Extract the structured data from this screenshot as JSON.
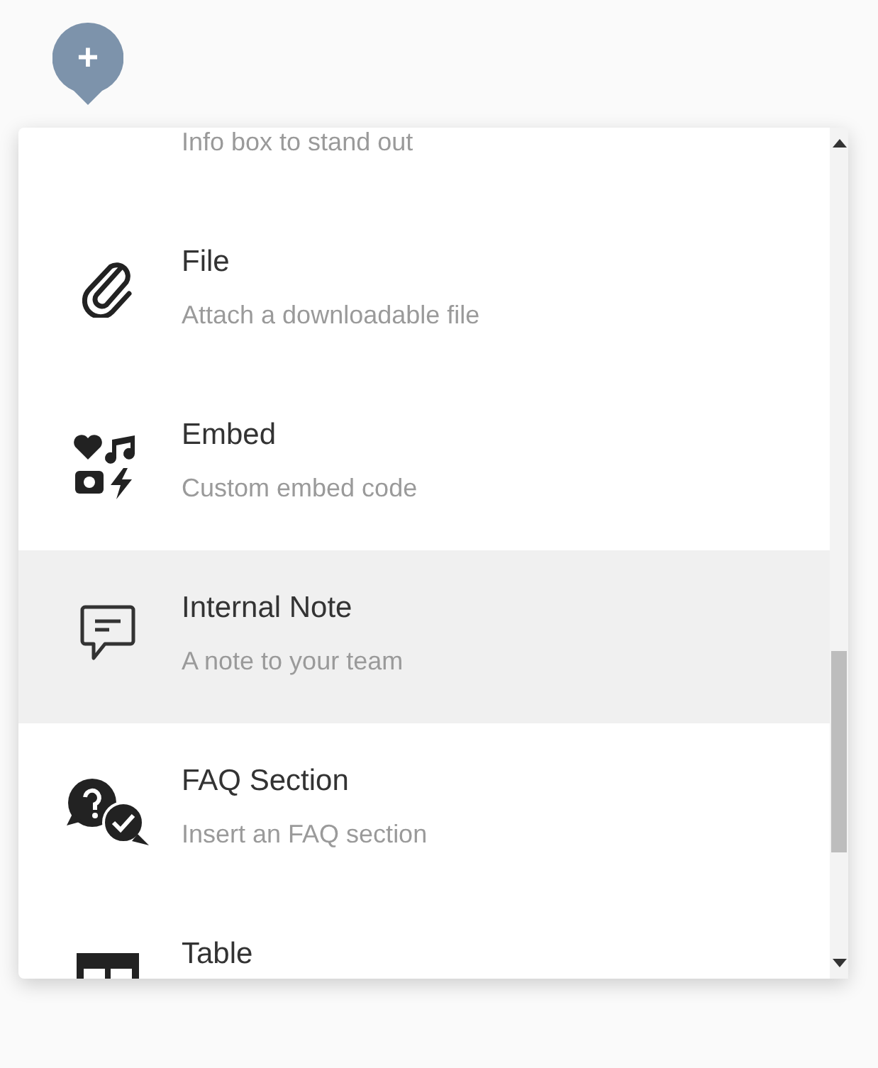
{
  "add_button": {
    "label": "+"
  },
  "insert_menu": {
    "items": [
      {
        "kind": "box",
        "description": "Info box to stand out",
        "selected": false
      },
      {
        "kind": "file",
        "title": "File",
        "description": "Attach a downloadable file",
        "selected": false
      },
      {
        "kind": "embed",
        "title": "Embed",
        "description": "Custom embed code",
        "selected": false
      },
      {
        "kind": "note",
        "title": "Internal Note",
        "description": "A note to your team",
        "selected": true
      },
      {
        "kind": "faq",
        "title": "FAQ Section",
        "description": "Insert an FAQ section",
        "selected": false
      },
      {
        "kind": "table",
        "title": "Table",
        "selected": false
      }
    ]
  }
}
